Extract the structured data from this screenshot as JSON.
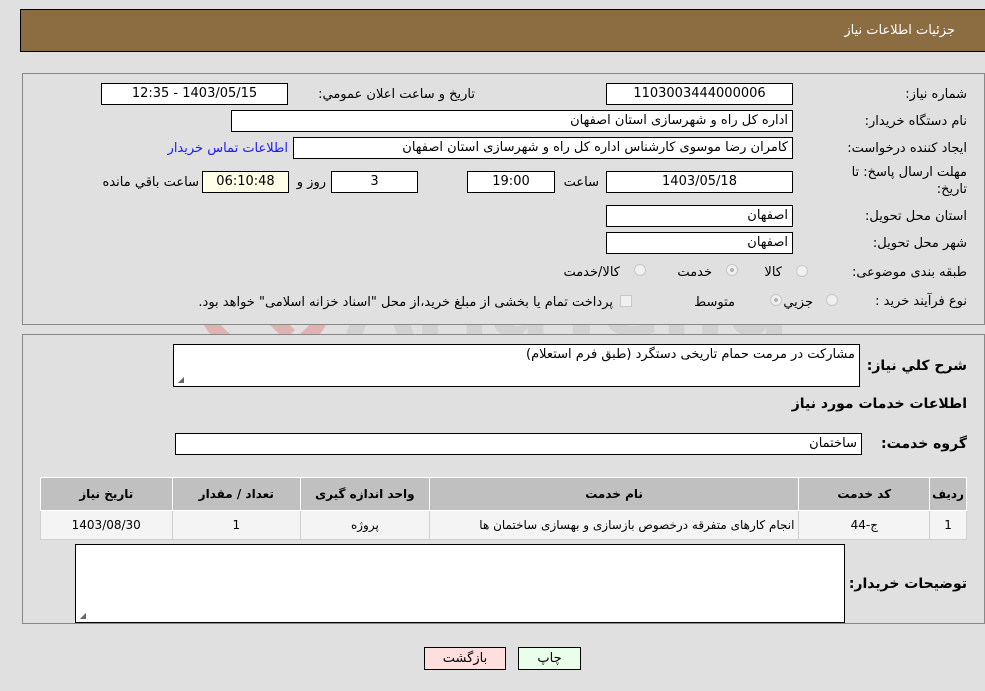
{
  "header": {
    "title": "جزئیات اطلاعات نیاز"
  },
  "form": {
    "need_number": {
      "label": "شماره نیاز:",
      "value": "1103003444000006"
    },
    "announce_datetime": {
      "label": "تاريخ و ساعت اعلان عمومي:",
      "value": "1403/05/15 - 12:35"
    },
    "buyer_org": {
      "label": "نام دستگاه خريدار:",
      "value": "اداره کل راه و شهرسازی استان اصفهان"
    },
    "requester": {
      "label": "ايجاد کننده درخواست:",
      "value": "کامران رضا موسوی کارشناس اداره کل راه و شهرسازی استان اصفهان"
    },
    "buyer_contact_link": "اطلاعات تماس خريدار",
    "deadline": {
      "label_line1": "مهلت ارسال پاسخ: تا",
      "label_line2": "تاريخ:",
      "date": "1403/05/18",
      "time_label": "ساعت",
      "time": "19:00",
      "days": "3",
      "days_label": "روز و",
      "remaining": "06:10:48",
      "remaining_label": "ساعت باقي مانده"
    },
    "delivery_province": {
      "label": "استان محل تحويل:",
      "value": "اصفهان"
    },
    "delivery_city": {
      "label": "شهر محل تحويل:",
      "value": "اصفهان"
    },
    "category": {
      "label": "طبقه بندی موضوعی:",
      "options": [
        "کالا",
        "خدمت",
        "کالا/خدمت"
      ],
      "selected": "خدمت"
    },
    "purchase_type": {
      "label": "نوع فرآيند خريد :",
      "options": [
        "جزيي",
        "متوسط"
      ],
      "selected": "متوسط",
      "treasury_note": "پرداخت تمام يا بخشی از مبلغ خريد،از محل \"اسناد خزانه اسلامی\" خواهد بود."
    }
  },
  "details": {
    "summary_label": "شرح کلي نياز:",
    "summary_value": "مشارکت در مرمت حمام تاریخی دستگرد (طبق فرم استعلام)",
    "services_heading": "اطلاعات خدمات مورد نياز",
    "service_group_label": "گروه خدمت:",
    "service_group_value": "ساختمان",
    "table": {
      "headers": [
        "رديف",
        "کد خدمت",
        "نام خدمت",
        "واحد اندازه گيری",
        "تعداد / مقدار",
        "تاريخ نياز"
      ],
      "rows": [
        [
          "1",
          "ج-44",
          "انجام کارهای متفرقه درخصوص بازسازی و بهسازی ساختمان ها",
          "پروژه",
          "1",
          "1403/08/30"
        ]
      ]
    },
    "buyer_notes_label": "توضيحات خريدار:",
    "buyer_notes_value": ""
  },
  "buttons": {
    "print": "چاپ",
    "back": "بازگشت"
  },
  "colors": {
    "header_bg": "#8c6d42",
    "print_bg": "#eaffea",
    "back_bg": "#ffdede",
    "link": "#1a1aff"
  }
}
